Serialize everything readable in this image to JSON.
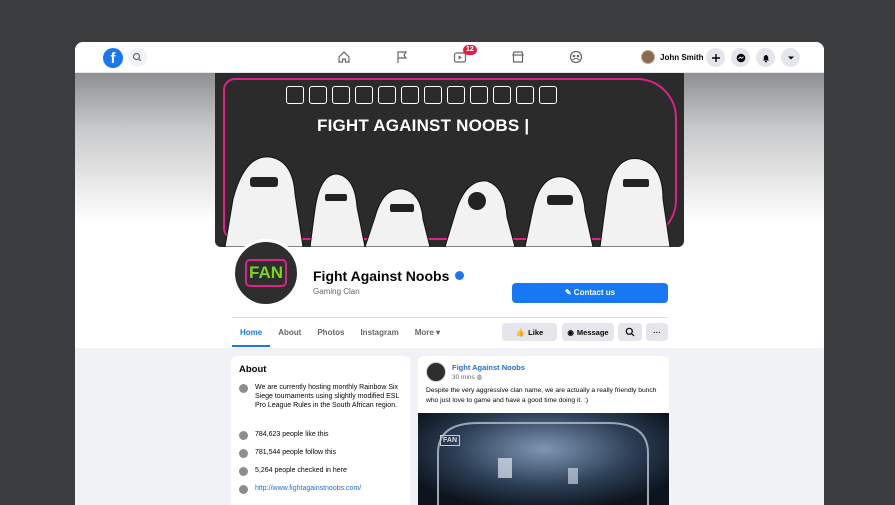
{
  "nav": {
    "profile_name": "John Smith",
    "notifications_badge": "12"
  },
  "cover": {
    "title": "FIGHT AGAINST NOOBS |",
    "social_icons": [
      "play-icon",
      "discord-icon",
      "instagram-icon",
      "twitter-icon",
      "facebook-icon",
      "whatsapp-icon",
      "twitch-icon",
      "patreon-icon",
      "phone-icon",
      "patreon-alt-icon",
      "steam-icon",
      "origin-icon"
    ]
  },
  "page": {
    "avatar_text": "FAN",
    "name": "Fight Against Noobs",
    "category": "Gaming Clan",
    "contact_label": "Contact us"
  },
  "tabs": [
    "Home",
    "About",
    "Photos",
    "Instagram",
    "More"
  ],
  "actions": {
    "like": "Like",
    "message": "Message"
  },
  "about": {
    "title": "About",
    "description": "We are currently hosting monthly Rainbow Six Siege tournaments using slightly modified ESL Pro League Rules in the South African region.",
    "likes": "784,623 people like this",
    "follows": "781,544 people follow this",
    "checkins": "5,264 people checked in here",
    "website": "http://www.fightagainstnoobs.com/"
  },
  "post": {
    "author": "Fight Against Noobs",
    "time": "30 mins",
    "text": "Despite the very aggressive clan name, we are actually a really friendly bunch who just love to game and have a good time doing it. :)",
    "media_watermark": "FAN"
  },
  "colors": {
    "accent": "#1877f2",
    "brand_pink": "#e0218a",
    "brand_green": "#7ed321"
  }
}
